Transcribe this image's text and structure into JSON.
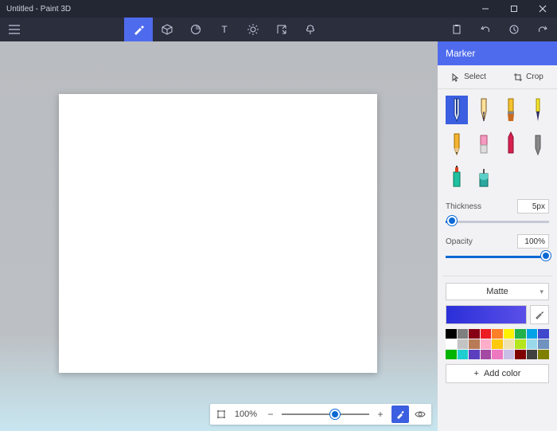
{
  "window": {
    "title": "Untitled - Paint 3D"
  },
  "panel": {
    "title": "Marker",
    "select_label": "Select",
    "crop_label": "Crop",
    "thickness_label": "Thickness",
    "thickness_value": "5px",
    "thickness_percent": 6,
    "opacity_label": "Opacity",
    "opacity_value": "100%",
    "opacity_percent": 100,
    "material_label": "Matte",
    "addcolor_label": "Add color",
    "current_color": "#4238e0"
  },
  "zoom": {
    "label": "100%"
  },
  "brushes": [
    {
      "name": "marker",
      "active": true
    },
    {
      "name": "calligraphy-pen",
      "active": false
    },
    {
      "name": "oil-brush",
      "active": false
    },
    {
      "name": "watercolor",
      "active": false
    },
    {
      "name": "pencil",
      "active": false
    },
    {
      "name": "eraser",
      "active": false
    },
    {
      "name": "crayon",
      "active": false
    },
    {
      "name": "pixel-pen",
      "active": false
    },
    {
      "name": "spray-can",
      "active": false
    },
    {
      "name": "fill",
      "active": false
    }
  ],
  "palette": [
    "#000000",
    "#7f7f7f",
    "#870014",
    "#ec1c23",
    "#ff7f26",
    "#fef200",
    "#22b14c",
    "#00a3e8",
    "#3f48cc",
    "#ffffff",
    "#c3c3c3",
    "#b97a57",
    "#feaec9",
    "#ffc90d",
    "#efe3af",
    "#b4e51d",
    "#99d9ea",
    "#7092be",
    "#00b400",
    "#1fced1",
    "#5c3fbf",
    "#a349a3",
    "#ee78c0",
    "#c8bfe7",
    "#7f0000",
    "#404040",
    "#808000"
  ]
}
